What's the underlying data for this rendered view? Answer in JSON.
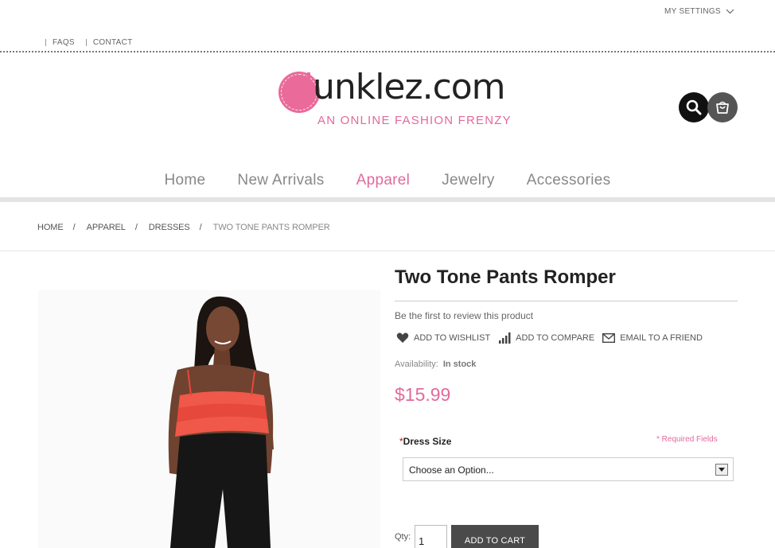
{
  "header": {
    "my_settings": "MY SETTINGS",
    "toplinks": [
      "FAQS",
      "CONTACT"
    ]
  },
  "logo": {
    "name_d": "d",
    "name_rest": "unklez.com",
    "tagline": "AN ONLINE FASHION FRENZY"
  },
  "nav": {
    "items": [
      {
        "label": "Home",
        "active": false
      },
      {
        "label": "New Arrivals",
        "active": false
      },
      {
        "label": "Apparel",
        "active": true
      },
      {
        "label": "Jewelry",
        "active": false
      },
      {
        "label": "Accessories",
        "active": false
      }
    ]
  },
  "breadcrumb": {
    "items": [
      "HOME",
      "APPAREL",
      "DRESSES"
    ],
    "current": "TWO TONE PANTS ROMPER",
    "separator": "/"
  },
  "product": {
    "title": "Two Tone Pants Romper",
    "review_text": "Be the first to review this product",
    "wishlist": "ADD TO WISHLIST",
    "compare": "ADD TO COMPARE",
    "email": "EMAIL TO A FRIEND",
    "availability_label": "Availability:",
    "availability_value": "In stock",
    "price": "$15.99",
    "option_required_mark": "*",
    "option_label": "Dress Size",
    "required_note": "* Required Fields",
    "select_value": "Choose an Option...",
    "qty_label": "Qty:",
    "qty_value": "1",
    "add_to_cart": "ADD TO CART"
  },
  "colors": {
    "brand_pink": "#e26a9b",
    "dark": "#111111",
    "button_gray": "#4a4a4a"
  }
}
